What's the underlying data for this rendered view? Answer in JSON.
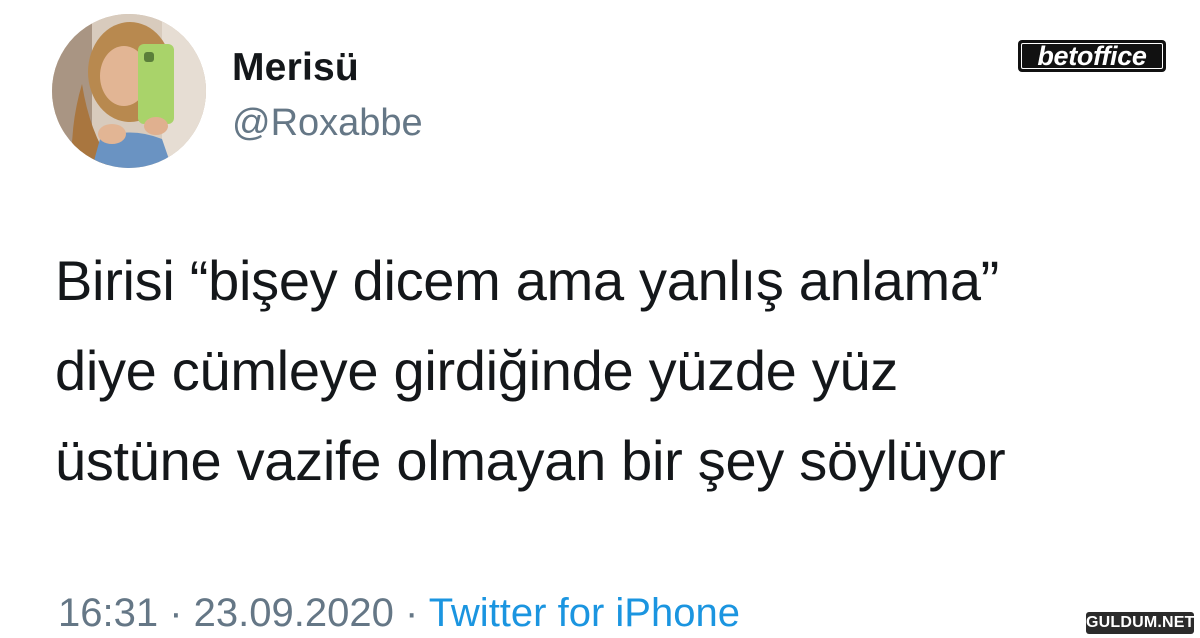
{
  "tweet": {
    "author": {
      "display_name": "Merisü",
      "handle": "@Roxabbe",
      "avatar_icon": "profile-photo"
    },
    "text_lines": [
      "Birisi “bişey dicem ama yanlış anlama”",
      "diye cümleye girdiğinde yüzde yüz",
      "üstüne vazife olmayan bir şey söylüyor"
    ],
    "time": "16:31",
    "separator": " · ",
    "date": "23.09.2020",
    "source": "Twitter for iPhone"
  },
  "watermarks": {
    "top": "betoffice",
    "bottom": "GULDUM.NET"
  },
  "colors": {
    "text": "#14171a",
    "secondary": "#657786",
    "link": "#1b95e0",
    "background": "#ffffff"
  }
}
